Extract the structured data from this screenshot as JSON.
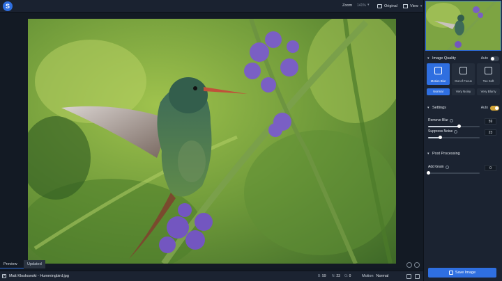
{
  "topbar": {
    "zoom_label": "Zoom",
    "zoom_value": "141%",
    "original_label": "Original",
    "view_label": "View"
  },
  "tabs": {
    "preview": "Preview",
    "updated": "Updated"
  },
  "file": {
    "name": "Matt Kloskowski - Hummingbird.jpg",
    "b_label": "B:",
    "b_value": "59",
    "n_label": "N:",
    "n_value": "23",
    "g_label": "G:",
    "g_value": "0",
    "model_label": "Motion",
    "model_value": "Normal"
  },
  "panel": {
    "image_quality": {
      "title": "Image Quality",
      "auto_label": "Auto",
      "auto_on": false,
      "models": [
        {
          "label": "Motion Blur",
          "icon": "motion-blur-icon",
          "active": true
        },
        {
          "label": "Out of Focus",
          "icon": "out-of-focus-icon",
          "active": false
        },
        {
          "label": "Too Soft",
          "icon": "too-soft-icon",
          "active": false
        }
      ],
      "blur_types": [
        {
          "label": "Normal",
          "active": true
        },
        {
          "label": "Very Noisy",
          "active": false
        },
        {
          "label": "Very Blurry",
          "active": false
        }
      ]
    },
    "settings": {
      "title": "Settings",
      "auto_label": "Auto",
      "auto_on": true,
      "remove_blur": {
        "label": "Remove Blur",
        "value": "59",
        "fraction": 0.59
      },
      "suppress_noise": {
        "label": "Suppress Noise",
        "value": "23",
        "fraction": 0.23
      }
    },
    "post_processing": {
      "title": "Post Processing",
      "add_grain": {
        "label": "Add Grain",
        "value": "0",
        "fraction": 0.0
      }
    },
    "save_label": "Save Image"
  },
  "colors": {
    "accent": "#2f6fe0",
    "toggle_on": "#d2a437",
    "panel_bg": "#1b2331",
    "app_bg": "#121923"
  }
}
